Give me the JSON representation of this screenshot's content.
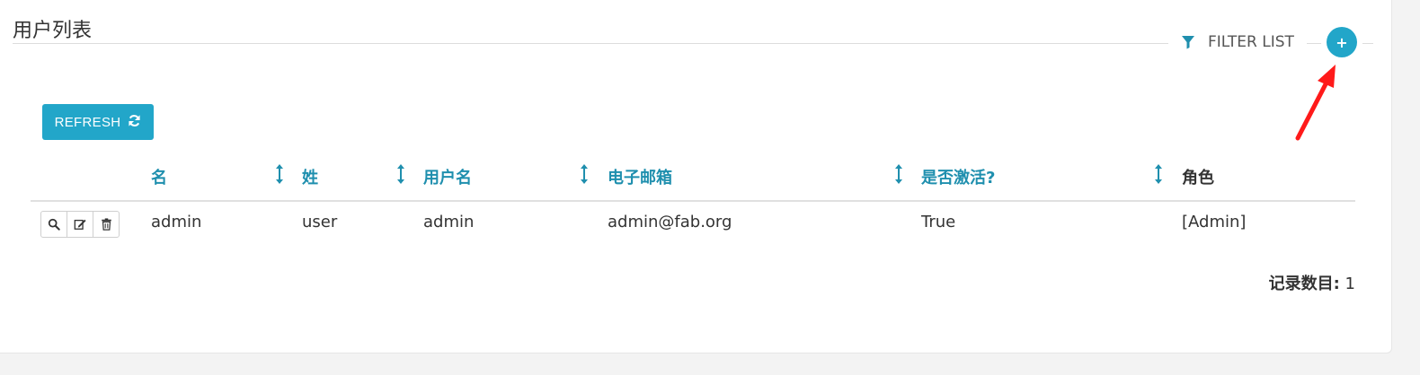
{
  "page": {
    "title": "用户列表"
  },
  "filter": {
    "label": "FILTER LIST",
    "icon": "filter-icon"
  },
  "add_button": {
    "icon": "plus-icon",
    "symbol": "+"
  },
  "refresh": {
    "label": "REFRESH",
    "icon": "refresh-icon"
  },
  "colors": {
    "accent": "#22a6c9",
    "header_text": "#1f8fae",
    "annotation": "#ff1a1a"
  },
  "table": {
    "columns": [
      "名",
      "姓",
      "用户名",
      "电子邮箱",
      "是否激活?",
      "角色"
    ],
    "rows": [
      {
        "first_name": "admin",
        "last_name": "user",
        "username": "admin",
        "email": "admin@fab.org",
        "active": "True",
        "roles": "[Admin]"
      }
    ],
    "row_actions": [
      "search-icon",
      "edit-icon",
      "trash-icon"
    ]
  },
  "record_count": {
    "label": "记录数目:",
    "value": "1"
  }
}
